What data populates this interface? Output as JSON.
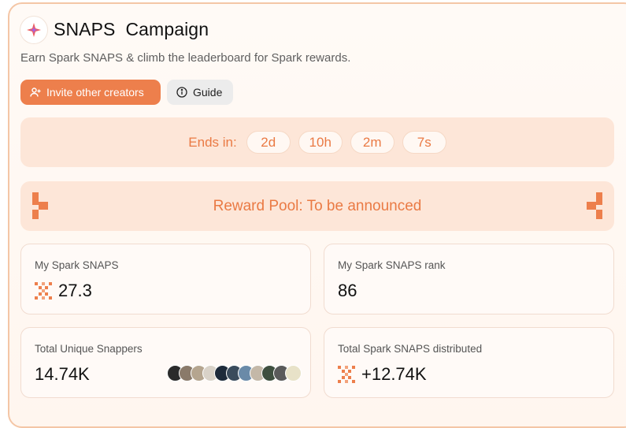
{
  "campaign": {
    "title": "SNAPS  Campaign",
    "subtitle": "Earn Spark SNAPS & climb the leaderboard for Spark rewards."
  },
  "actions": {
    "invite_label": "Invite other creators",
    "guide_label": "Guide"
  },
  "countdown": {
    "label": "Ends in:",
    "days": "2d",
    "hours": "10h",
    "minutes": "2m",
    "seconds": "7s"
  },
  "reward_pool": {
    "text": "Reward Pool: To be announced"
  },
  "stats": {
    "my_snaps": {
      "label": "My Spark SNAPS",
      "value": "27.3"
    },
    "my_rank": {
      "label": "My Spark SNAPS rank",
      "value": "86"
    },
    "unique_snappers": {
      "label": "Total Unique Snappers",
      "value": "14.74K"
    },
    "distributed": {
      "label": "Total Spark SNAPS distributed",
      "value": "+12.74K"
    }
  },
  "avatar_colors": [
    "#2b2b2b",
    "#8a7a6a",
    "#b5a58f",
    "#d9d2c8",
    "#1d2a3a",
    "#3a4b5c",
    "#6a8aa8",
    "#c4b8a8",
    "#3f4f3f",
    "#5a5a5a",
    "#e8e2c8"
  ],
  "colors": {
    "accent": "#ED7F4C",
    "accent_soft": "#FDE6D8",
    "border": "#F4C6A6"
  }
}
